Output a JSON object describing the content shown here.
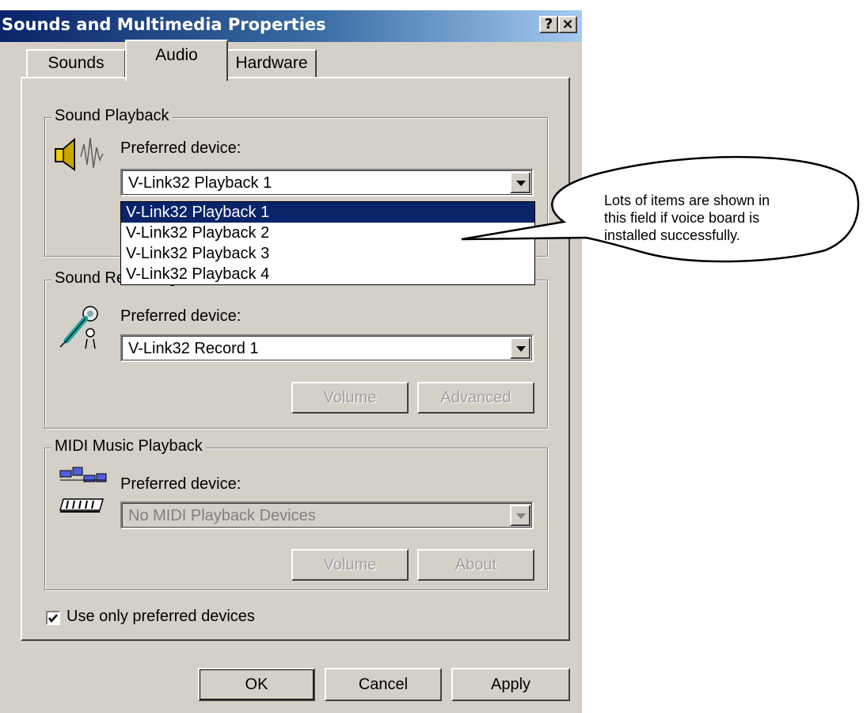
{
  "window": {
    "title": "Sounds and Multimedia Properties",
    "help_label": "?",
    "close_label": "×"
  },
  "tabs": [
    {
      "label": "Sounds"
    },
    {
      "label": "Audio"
    },
    {
      "label": "Hardware"
    }
  ],
  "playback": {
    "group_label": "Sound Playback",
    "pref_label": "Preferred device:",
    "selected": "V-Link32 Playback 1",
    "options": [
      "V-Link32 Playback 1",
      "V-Link32 Playback 2",
      "V-Link32 Playback 3",
      "V-Link32 Playback 4"
    ],
    "icon": "speaker-icon"
  },
  "recording": {
    "group_label": "Sound Recording",
    "pref_label": "Preferred device:",
    "selected": "V-Link32 Record 1",
    "volume_label": "Volume",
    "advanced_label": "Advanced",
    "icon": "microphone-icon"
  },
  "midi": {
    "group_label": "MIDI Music Playback",
    "pref_label": "Preferred device:",
    "selected": "No MIDI Playback Devices",
    "volume_label": "Volume",
    "about_label": "About",
    "icon": "midi-keyboard-icon"
  },
  "options": {
    "use_only_preferred": "Use only preferred devices",
    "use_only_preferred_checked": true
  },
  "footer": {
    "ok_label": "OK",
    "cancel_label": "Cancel",
    "apply_label": "Apply"
  },
  "callout": {
    "text": "Lots of items are shown in\nthis field if voice board is\ninstalled successfully."
  },
  "colors": {
    "face": "#d4d0c8",
    "titlebar_start": "#0a246a",
    "titlebar_end": "#a6caf0",
    "selection": "#0a246a"
  }
}
